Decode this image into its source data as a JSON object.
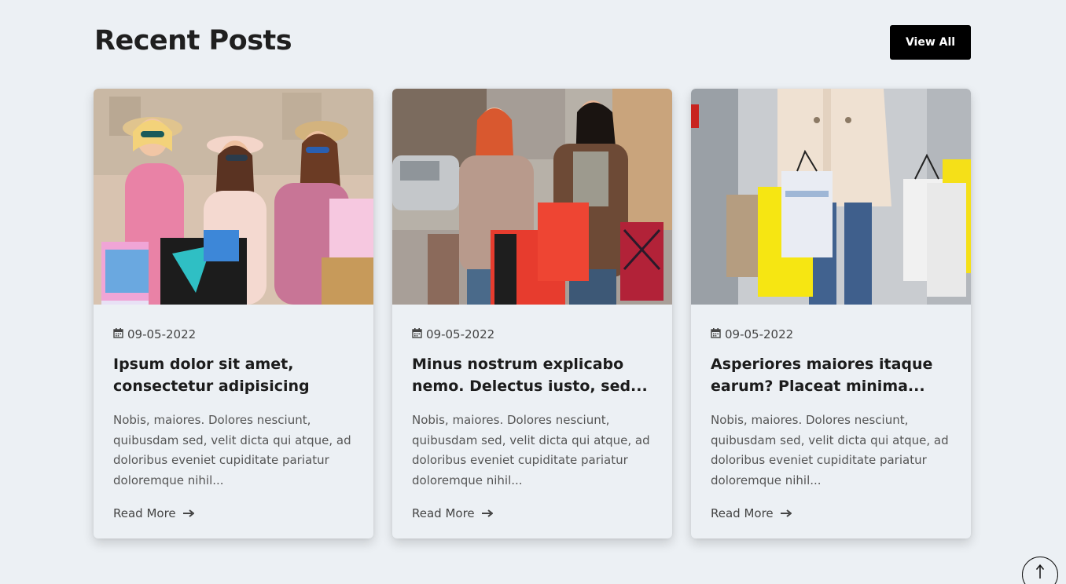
{
  "section": {
    "title": "Recent Posts",
    "view_all_label": "View All"
  },
  "posts": [
    {
      "date": "09-05-2022",
      "title": "Ipsum dolor sit amet, consectetur adipisicing elit....",
      "excerpt": "Nobis, maiores. Dolores nesciunt, quibusdam sed, velit dicta qui atque, ad doloribus eveniet cupiditate pariatur doloremque nihil...",
      "read_more": "Read More"
    },
    {
      "date": "09-05-2022",
      "title": "Minus nostrum explicabo nemo. Delectus iusto, sed...",
      "excerpt": "Nobis, maiores. Dolores nesciunt, quibusdam sed, velit dicta qui atque, ad doloribus eveniet cupiditate pariatur doloremque nihil...",
      "read_more": "Read More"
    },
    {
      "date": "09-05-2022",
      "title": "Asperiores maiores itaque earum? Placeat minima...",
      "excerpt": "Nobis, maiores. Dolores nesciunt, quibusdam sed, velit dicta qui atque, ad doloribus eveniet cupiditate pariatur doloremque nihil...",
      "read_more": "Read More"
    }
  ],
  "icons": {
    "date": "calendar-icon",
    "read_more": "arrow-right-icon",
    "scroll_top": "arrow-up-icon"
  },
  "colors": {
    "background": "#ecf0f4",
    "button": "#000000",
    "title": "#1c1c1c"
  }
}
